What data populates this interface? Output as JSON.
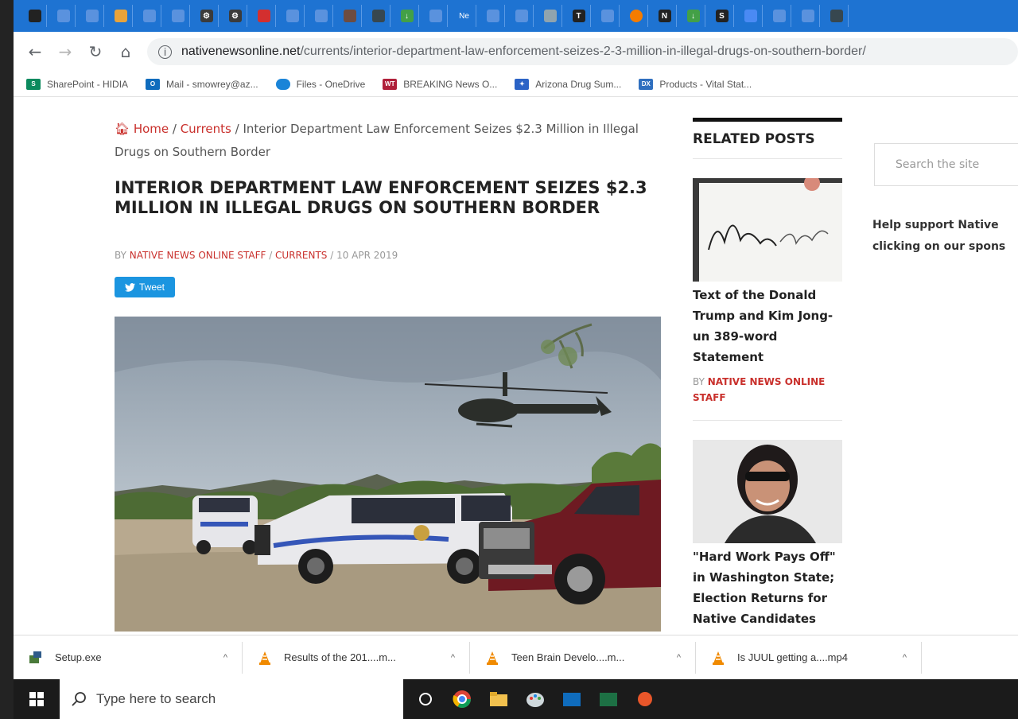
{
  "browser": {
    "url_host": "nativenewsonline.net",
    "url_path": "/currents/interior-department-law-enforcement-seizes-2-3-million-in-illegal-drugs-on-southern-border/",
    "tab_label_ne": "Ne",
    "bookmarks": [
      {
        "label": "SharePoint - HIDIA",
        "color": "#0b8a5e"
      },
      {
        "label": "Mail - smowrey@az...",
        "color": "#0f6cbd"
      },
      {
        "label": "Files - OneDrive",
        "color": "#1a84d8"
      },
      {
        "label": "BREAKING News O...",
        "color": "#b0203a"
      },
      {
        "label": "Arizona Drug Sum...",
        "color": "#2b63c6"
      },
      {
        "label": "Products - Vital Stat...",
        "color": "#2f6fbf"
      }
    ]
  },
  "article": {
    "breadcrumb": {
      "home": "Home",
      "sep1": " / ",
      "currents": "Currents",
      "sep2": " / ",
      "current": "Interior Department Law Enforcement Seizes $2.3 Million in Illegal Drugs on Southern Border"
    },
    "title": "INTERIOR DEPARTMENT LAW ENFORCEMENT SEIZES $2.3 MILLION IN ILLEGAL DRUGS ON SOUTHERN BORDER",
    "byline": {
      "prefix": "BY ",
      "author": "NATIVE NEWS ONLINE STAFF",
      "sep1": " /  ",
      "category": "CURRENTS",
      "sep2": " / ",
      "date": "10 APR 2019"
    },
    "tweet_label": "Tweet"
  },
  "sidebar": {
    "related_title": "RELATED POSTS",
    "posts": [
      {
        "title": "Text of the Donald Trump and Kim Jong-un 389-word Statement",
        "by_prefix": "BY ",
        "author": "NATIVE NEWS ONLINE STAFF"
      },
      {
        "title": "\"Hard Work Pays Off\" in Washington State; Election Returns for Native Candidates"
      }
    ],
    "search_placeholder": "Search the site",
    "support_line1": "Help support Native",
    "support_line2": "clicking on our spons"
  },
  "downloads": [
    {
      "name": "Setup.exe",
      "icon": "installer-icon"
    },
    {
      "name": "Results of the 201....m...",
      "icon": "vlc-icon"
    },
    {
      "name": "Teen Brain Develo....m...",
      "icon": "vlc-icon"
    },
    {
      "name": "Is JUUL getting a....mp4",
      "icon": "vlc-icon"
    }
  ],
  "taskbar": {
    "search_placeholder": "Type here to search"
  },
  "colors": {
    "accent_red": "#c9302c",
    "tab_strip_blue": "#1e73d2",
    "tweet_blue": "#1b95e0"
  }
}
